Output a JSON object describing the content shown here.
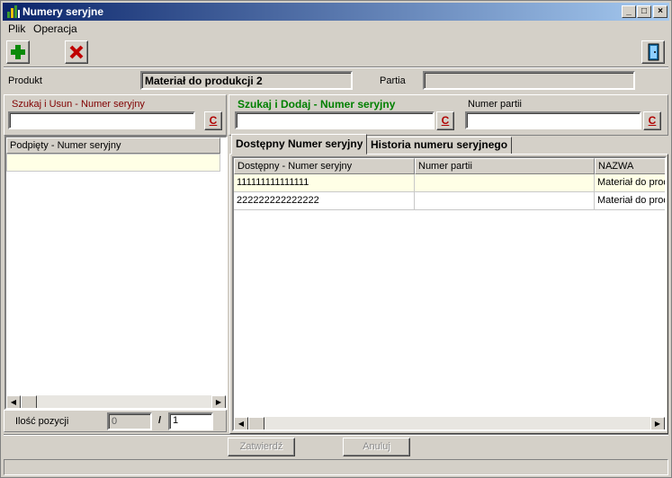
{
  "window": {
    "title": "Numery seryjne"
  },
  "menu": {
    "file": "Plik",
    "operation": "Operacja"
  },
  "product": {
    "label": "Produkt",
    "value": "Materiał do produkcji 2",
    "batch_label": "Partia",
    "batch_value": ""
  },
  "left": {
    "search_label": "Szukaj i Usun - Numer seryjny",
    "search_value": "",
    "clear_label": "C",
    "grid_header": "Podpięty - Numer seryjny",
    "count_label": "Ilość pozycji",
    "count_value": "0",
    "separator": "/",
    "total_value": "1"
  },
  "right": {
    "search_label": "Szukaj i Dodaj - Numer seryjny",
    "search_value": "",
    "clear_label": "C",
    "batch_label": "Numer partii",
    "batch_value": "",
    "batch_clear_label": "C",
    "tabs": [
      "Dostępny Numer seryjny",
      "Historia numeru seryjnego"
    ],
    "columns": [
      "Dostępny - Numer seryjny",
      "Numer partii",
      "NAZWA"
    ],
    "rows": [
      {
        "serial": "111111111111111",
        "batch": "",
        "name": "Materiał do prod"
      },
      {
        "serial": "222222222222222",
        "batch": "",
        "name": "Materiał do prod"
      }
    ]
  },
  "buttons": {
    "confirm": "Zatwierdź",
    "cancel": "Anuluj"
  },
  "colors": {
    "titlebar": "#0a246a",
    "left_search_label": "#800000",
    "right_search_label": "#008000",
    "selected_row": "#ffffe6"
  }
}
